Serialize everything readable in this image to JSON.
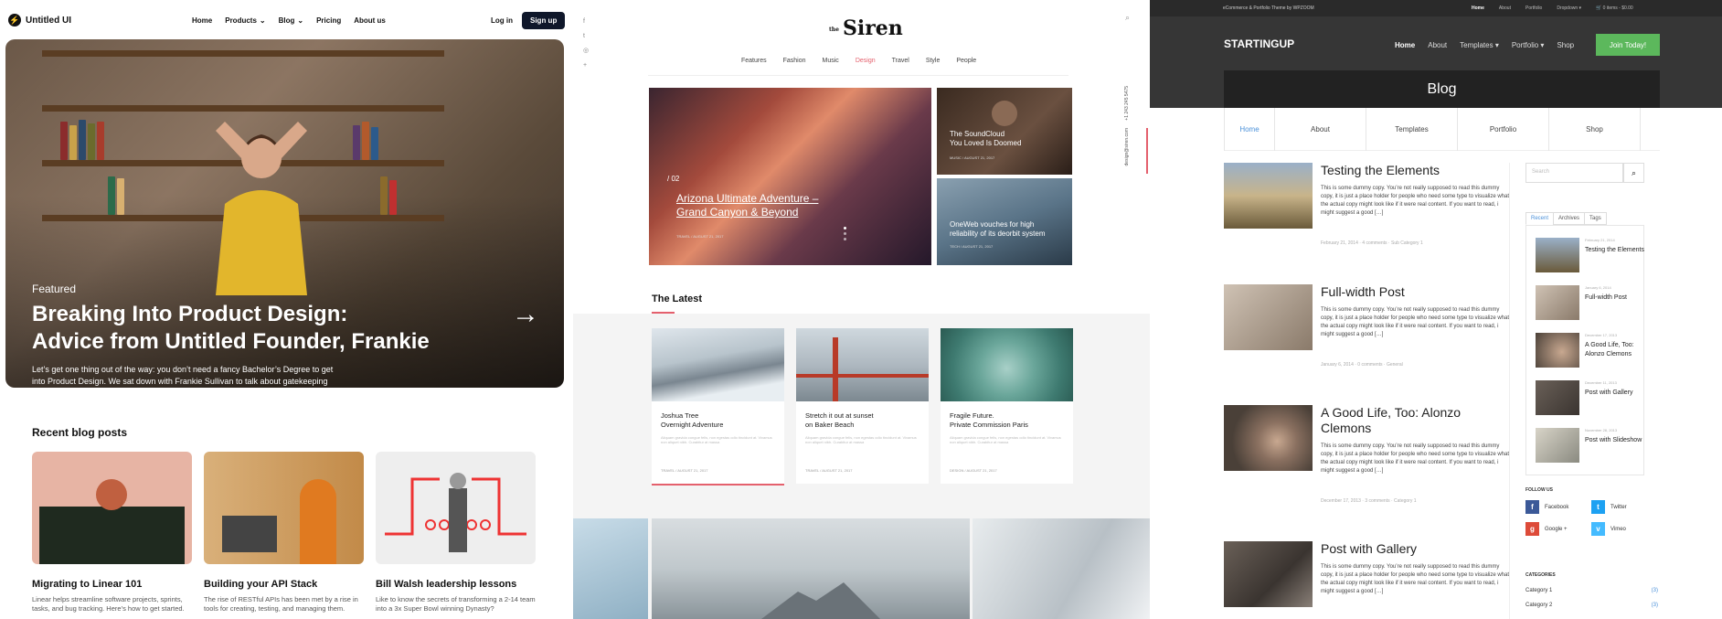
{
  "left_panel": {
    "brand": "Untitled UI",
    "nav": {
      "home": "Home",
      "products": "Products",
      "blog": "Blog",
      "pricing": "Pricing",
      "about": "About us"
    },
    "login": "Log in",
    "signup": "Sign up",
    "hero": {
      "eyebrow": "Featured",
      "title_line1": "Breaking Into Product Design:",
      "title_line2": "Advice from Untitled Founder, Frankie",
      "description": "Let’s get one thing out of the way: you don’t need a fancy Bachelor’s Degree to get into Product Design. We sat down with Frankie Sullivan to talk about gatekeeping in product design and how anyone can get into this growing industry."
    },
    "recent_heading": "Recent blog posts",
    "cards": [
      {
        "title": "Migrating to Linear 101",
        "excerpt": "Linear helps streamline software projects, sprints, tasks, and bug tracking. Here’s how to get started."
      },
      {
        "title": "Building your API Stack",
        "excerpt": "The rise of RESTful APIs has been met by a rise in tools for creating, testing, and managing them."
      },
      {
        "title": "Bill Walsh leadership lessons",
        "excerpt": "Like to know the secrets of transforming a 2-14 team into a 3x Super Bowl winning Dynasty?"
      }
    ]
  },
  "middle_panel": {
    "social": [
      "f",
      "t",
      "◎",
      "+"
    ],
    "logo_small": "the",
    "logo": "Siren",
    "menu": [
      "Features",
      "Fashion",
      "Music",
      "Design",
      "Travel",
      "Style",
      "People"
    ],
    "active_menu": "Design",
    "hero": {
      "number": "/ 02",
      "title_line1": "Arizona Ultimate Adventure –",
      "title_line2": "Grand Canyon & Beyond",
      "meta": "TRAVEL  /  AUGUST 21, 2017"
    },
    "side_posts": [
      {
        "title_line1": "The SoundCloud",
        "title_line2": "You Loved Is Doomed",
        "meta": "MUSIC  /  AUGUST 21, 2017"
      },
      {
        "title_line1": "OneWeb vouches for high",
        "title_line2": "reliability of its deorbit system",
        "meta": "TECH  /  AUGUST 21, 2017"
      }
    ],
    "contact_phone": "+1 243 245 5475",
    "contact_email": "design@siren.com",
    "latest_heading": "The Latest",
    "cards": [
      {
        "title_line1": "Joshua Tree",
        "title_line2": "Overnight Adventure",
        "excerpt": "Aliquam gravida congue felis, non egestas odio tincidunt at. Vivamus non aliquet nibh. Curabitur at massa",
        "meta": "TRAVEL  /  AUGUST 21, 2017"
      },
      {
        "title_line1": "Stretch it out at sunset",
        "title_line2": "on Baker Beach",
        "excerpt": "Aliquam gravida congue felis, non egestas odio tincidunt at. Vivamus non aliquet nibh. Curabitur at massa",
        "meta": "TRAVEL  /  AUGUST 21, 2017"
      },
      {
        "title_line1": "Fragile Future.",
        "title_line2": "Private Commission Paris",
        "excerpt": "Aliquam gravida congue felis, non egestas odio tincidunt at. Vivamus non aliquet nibh. Curabitur at massa",
        "meta": "DESIGN  /  AUGUST 21, 2017"
      }
    ]
  },
  "right_panel": {
    "tagline": "eCommerce & Portfolio Theme by WPZOOM",
    "top_links": [
      "Home",
      "About",
      "Portfolio",
      "Dropdown ▾",
      "🛒  0 items - $0.00"
    ],
    "brand": "STARTINGUP",
    "menu": [
      "Home",
      "About",
      "Templates ▾",
      "Portfolio ▾",
      "Shop"
    ],
    "cta": "Join Today!",
    "page_title": "Blog",
    "tabs": [
      "Home",
      "About",
      "Templates",
      "Portfolio",
      "Shop"
    ],
    "posts": [
      {
        "title": "Testing the Elements",
        "excerpt": "This is some dummy copy. You’re not really supposed to read this dummy copy, it is just a place holder for people who need some type to visualize what the actual copy might look like if it were real content. If you want to read, i might suggest a good […]",
        "meta": "February 21, 2014  ·  4 comments  ·  Sub Category 1"
      },
      {
        "title": "Full-width Post",
        "excerpt": "This is some dummy copy. You’re not really supposed to read this dummy copy, it is just a place holder for people who need some type to visualize what the actual copy might look like if it were real content. If you want to read, i might suggest a good […]",
        "meta": "January 6, 2014  ·  0 comments  ·  General"
      },
      {
        "title": "A Good Life, Too: Alonzo Clemons",
        "excerpt": "This is some dummy copy. You’re not really supposed to read this dummy copy, it is just a place holder for people who need some type to visualize what the actual copy might look like if it were real content. If you want to read, i might suggest a good […]",
        "meta": "December 17, 2013  ·  3 comments  ·  Category 1"
      },
      {
        "title": "Post with Gallery",
        "excerpt": "This is some dummy copy. You’re not really supposed to read this dummy copy, it is just a place holder for people who need some type to visualize what the actual copy might look like if it were real content. If you want to read, i might suggest a good […]",
        "meta": ""
      }
    ],
    "search_placeholder": "Search",
    "widget_tabs": [
      "Recent",
      "Archives",
      "Tags"
    ],
    "recent": [
      {
        "date": "February 21, 2014",
        "title": "Testing the Elements"
      },
      {
        "date": "January 6, 2014",
        "title": "Full-width Post"
      },
      {
        "date": "December 17, 2013",
        "title": "A Good Life, Too: Alonzo Clemons"
      },
      {
        "date": "December 11, 2013",
        "title": "Post with Gallery"
      },
      {
        "date": "November 28, 2013",
        "title": "Post with Slideshow"
      }
    ],
    "follow_heading": "FOLLOW US",
    "follow": [
      {
        "icon": "f",
        "label": "Facebook",
        "color": "#3b5998"
      },
      {
        "icon": "t",
        "label": "Twitter",
        "color": "#1da1f2"
      },
      {
        "icon": "g",
        "label": "Google +",
        "color": "#dd4b39"
      },
      {
        "icon": "v",
        "label": "Vimeo",
        "color": "#44bbff"
      }
    ],
    "categories_heading": "CATEGORIES",
    "categories": [
      {
        "name": "Category 1",
        "count": "(3)"
      },
      {
        "name": "Category 2",
        "count": "(3)"
      }
    ]
  }
}
